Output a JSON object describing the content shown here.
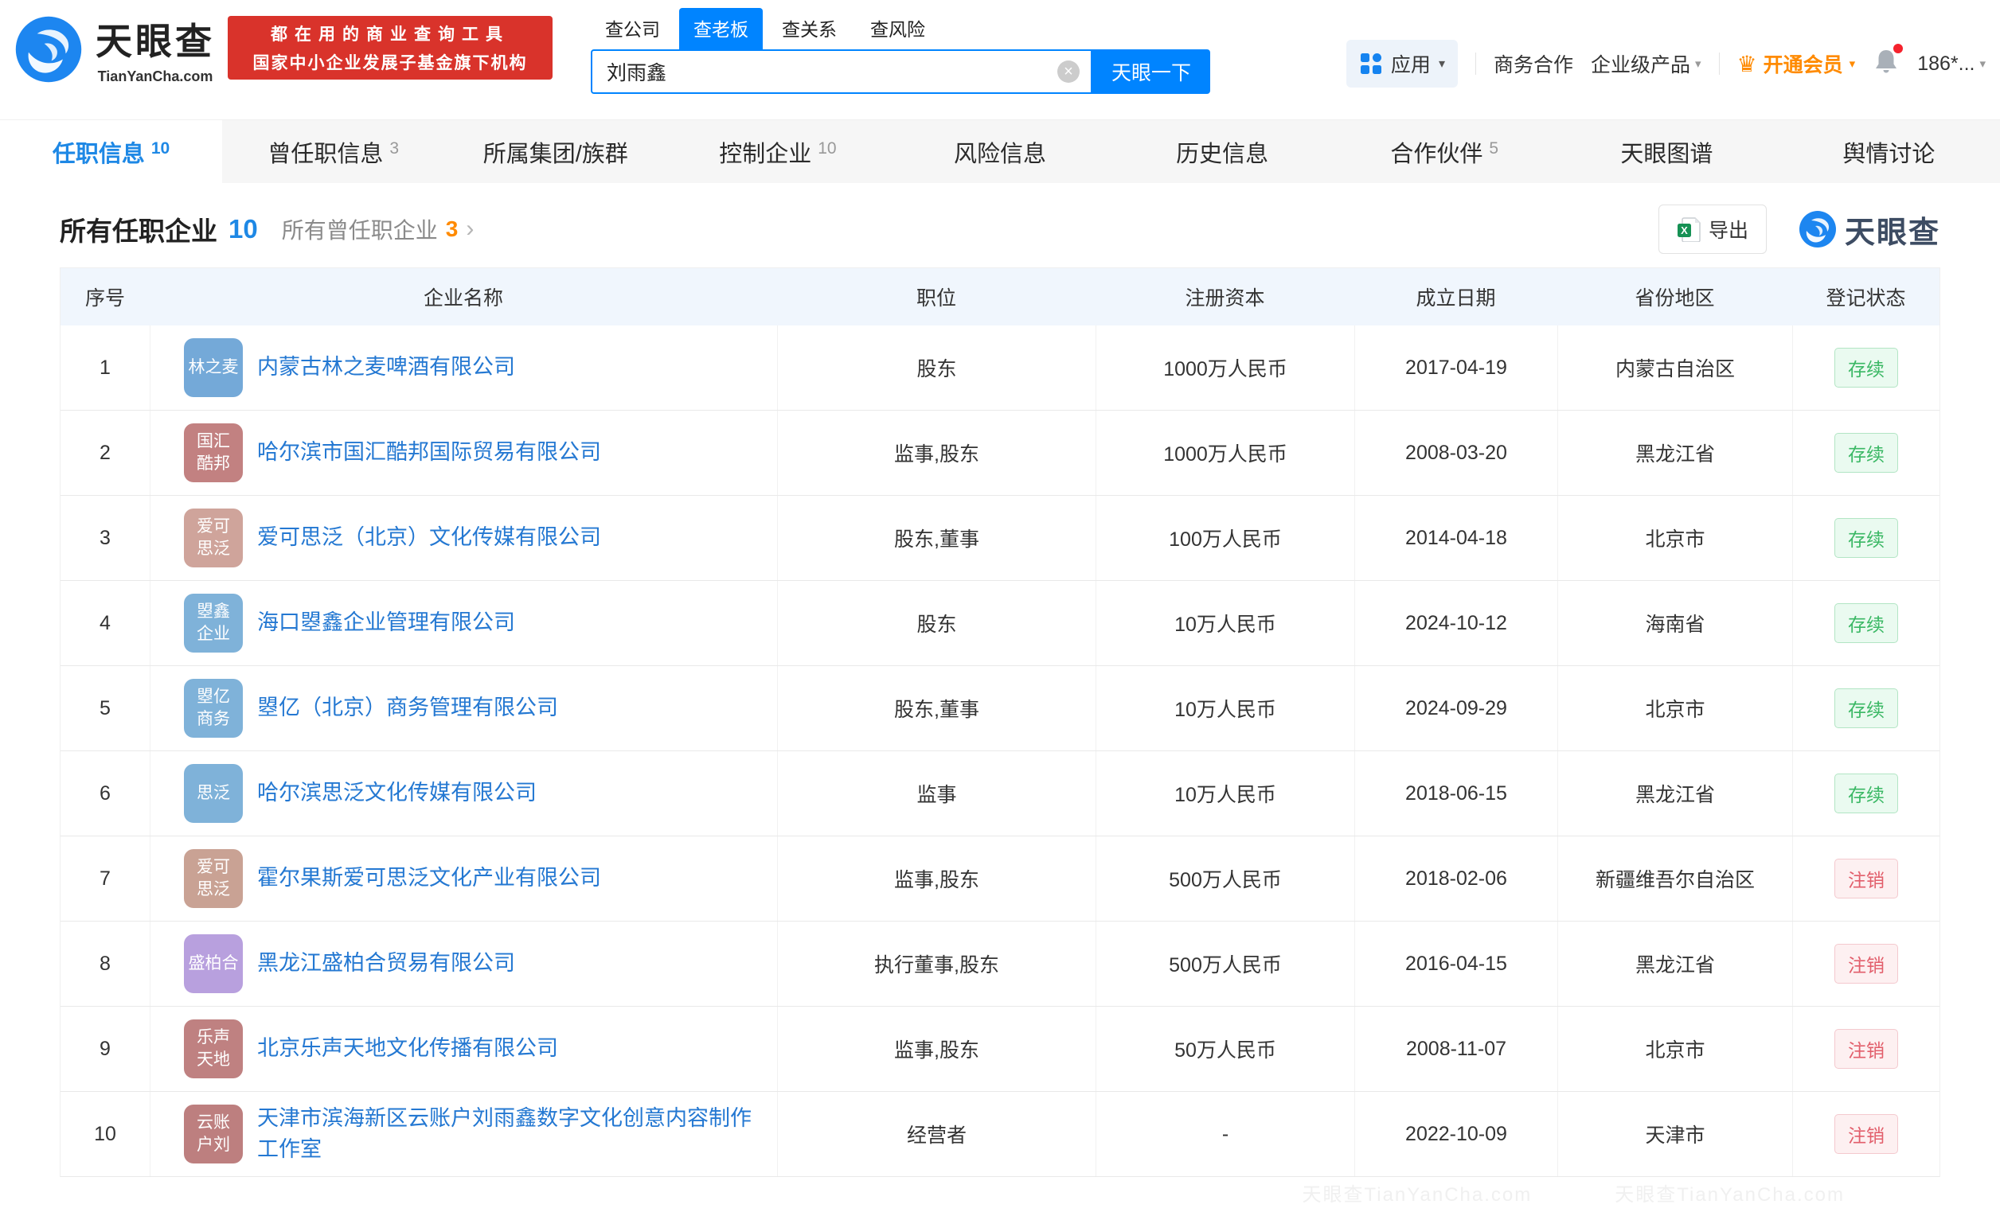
{
  "colors": {
    "brand_blue": "#0084ff",
    "link_blue": "#2478d2",
    "banner_red": "#d9332b",
    "vip_orange": "#ff8a00",
    "status_green": "#3bb865",
    "status_red": "#e25e6b"
  },
  "icons": {
    "crown": "♛",
    "caret": "▾",
    "chevron": "›",
    "clear": "×"
  },
  "header": {
    "logo": {
      "title": "天眼查",
      "subtitle": "TianYanCha.com"
    },
    "banner": {
      "line1": "都在用的商业查询工具",
      "line2": "国家中小企业发展子基金旗下机构"
    },
    "search": {
      "tabs": [
        {
          "label": "查公司"
        },
        {
          "label": "查老板",
          "active": true
        },
        {
          "label": "查关系"
        },
        {
          "label": "查风险"
        }
      ],
      "value": "刘雨鑫",
      "button": "天眼一下"
    },
    "menu": {
      "apps": "应用",
      "cooperation": "商务合作",
      "enterprise": "企业级产品",
      "vip": "开通会员",
      "user": "186*..."
    }
  },
  "nav": {
    "tabs": [
      {
        "label": "任职信息",
        "count": "10",
        "active": true
      },
      {
        "label": "曾任职信息",
        "count": "3"
      },
      {
        "label": "所属集团/族群"
      },
      {
        "label": "控制企业",
        "count": "10"
      },
      {
        "label": "风险信息"
      },
      {
        "label": "历史信息"
      },
      {
        "label": "合作伙伴",
        "count": "5"
      },
      {
        "label": "天眼图谱"
      },
      {
        "label": "舆情讨论"
      }
    ]
  },
  "section": {
    "title": "所有任职企业",
    "count": "10",
    "sub_title": "所有曾任职企业",
    "sub_count": "3",
    "export_label": "导出",
    "brand": "天眼查"
  },
  "table": {
    "headers": [
      "序号",
      "企业名称",
      "职位",
      "注册资本",
      "成立日期",
      "省份地区",
      "登记状态"
    ],
    "rows": [
      {
        "index": "1",
        "logo_lines": [
          "林之麦"
        ],
        "logo_color": "#74a9d8",
        "name": "内蒙古林之麦啤酒有限公司",
        "position": "股东",
        "capital": "1000万人民币",
        "date": "2017-04-19",
        "province": "内蒙古自治区",
        "status": "存续",
        "status_type": "active"
      },
      {
        "index": "2",
        "logo_lines": [
          "国汇",
          "酷邦"
        ],
        "logo_color": "#c28181",
        "name": "哈尔滨市国汇酷邦国际贸易有限公司",
        "position": "监事,股东",
        "capital": "1000万人民币",
        "date": "2008-03-20",
        "province": "黑龙江省",
        "status": "存续",
        "status_type": "active"
      },
      {
        "index": "3",
        "logo_lines": [
          "爱可",
          "思泛"
        ],
        "logo_color": "#cfa49b",
        "name": "爱可思泛（北京）文化传媒有限公司",
        "position": "股东,董事",
        "capital": "100万人民币",
        "date": "2014-04-18",
        "province": "北京市",
        "status": "存续",
        "status_type": "active"
      },
      {
        "index": "4",
        "logo_lines": [
          "曌鑫",
          "企业"
        ],
        "logo_color": "#7fb2d9",
        "name": "海口曌鑫企业管理有限公司",
        "position": "股东",
        "capital": "10万人民币",
        "date": "2024-10-12",
        "province": "海南省",
        "status": "存续",
        "status_type": "active"
      },
      {
        "index": "5",
        "logo_lines": [
          "曌亿",
          "商务"
        ],
        "logo_color": "#7fb2d9",
        "name": "曌亿（北京）商务管理有限公司",
        "position": "股东,董事",
        "capital": "10万人民币",
        "date": "2024-09-29",
        "province": "北京市",
        "status": "存续",
        "status_type": "active"
      },
      {
        "index": "6",
        "logo_lines": [
          "思泛"
        ],
        "logo_color": "#7fb2d9",
        "name": "哈尔滨思泛文化传媒有限公司",
        "position": "监事",
        "capital": "10万人民币",
        "date": "2018-06-15",
        "province": "黑龙江省",
        "status": "存续",
        "status_type": "active"
      },
      {
        "index": "7",
        "logo_lines": [
          "爱可",
          "思泛"
        ],
        "logo_color": "#c9a294",
        "name": "霍尔果斯爱可思泛文化产业有限公司",
        "position": "监事,股东",
        "capital": "500万人民币",
        "date": "2018-02-06",
        "province": "新疆维吾尔自治区",
        "status": "注销",
        "status_type": "cancelled"
      },
      {
        "index": "8",
        "logo_lines": [
          "盛柏合"
        ],
        "logo_color": "#b8a0de",
        "name": "黑龙江盛柏合贸易有限公司",
        "position": "执行董事,股东",
        "capital": "500万人民币",
        "date": "2016-04-15",
        "province": "黑龙江省",
        "status": "注销",
        "status_type": "cancelled"
      },
      {
        "index": "9",
        "logo_lines": [
          "乐声",
          "天地"
        ],
        "logo_color": "#bf8181",
        "name": "北京乐声天地文化传播有限公司",
        "position": "监事,股东",
        "capital": "50万人民币",
        "date": "2008-11-07",
        "province": "北京市",
        "status": "注销",
        "status_type": "cancelled"
      },
      {
        "index": "10",
        "logo_lines": [
          "云账",
          "户刘"
        ],
        "logo_color": "#bd7f7f",
        "name": "天津市滨海新区云账户刘雨鑫数字文化创意内容制作工作室",
        "position": "经营者",
        "capital": "-",
        "date": "2022-10-09",
        "province": "天津市",
        "status": "注销",
        "status_type": "cancelled"
      }
    ]
  },
  "watermark": "天眼查TianYanCha.com　　　　天眼查TianYanCha.com"
}
